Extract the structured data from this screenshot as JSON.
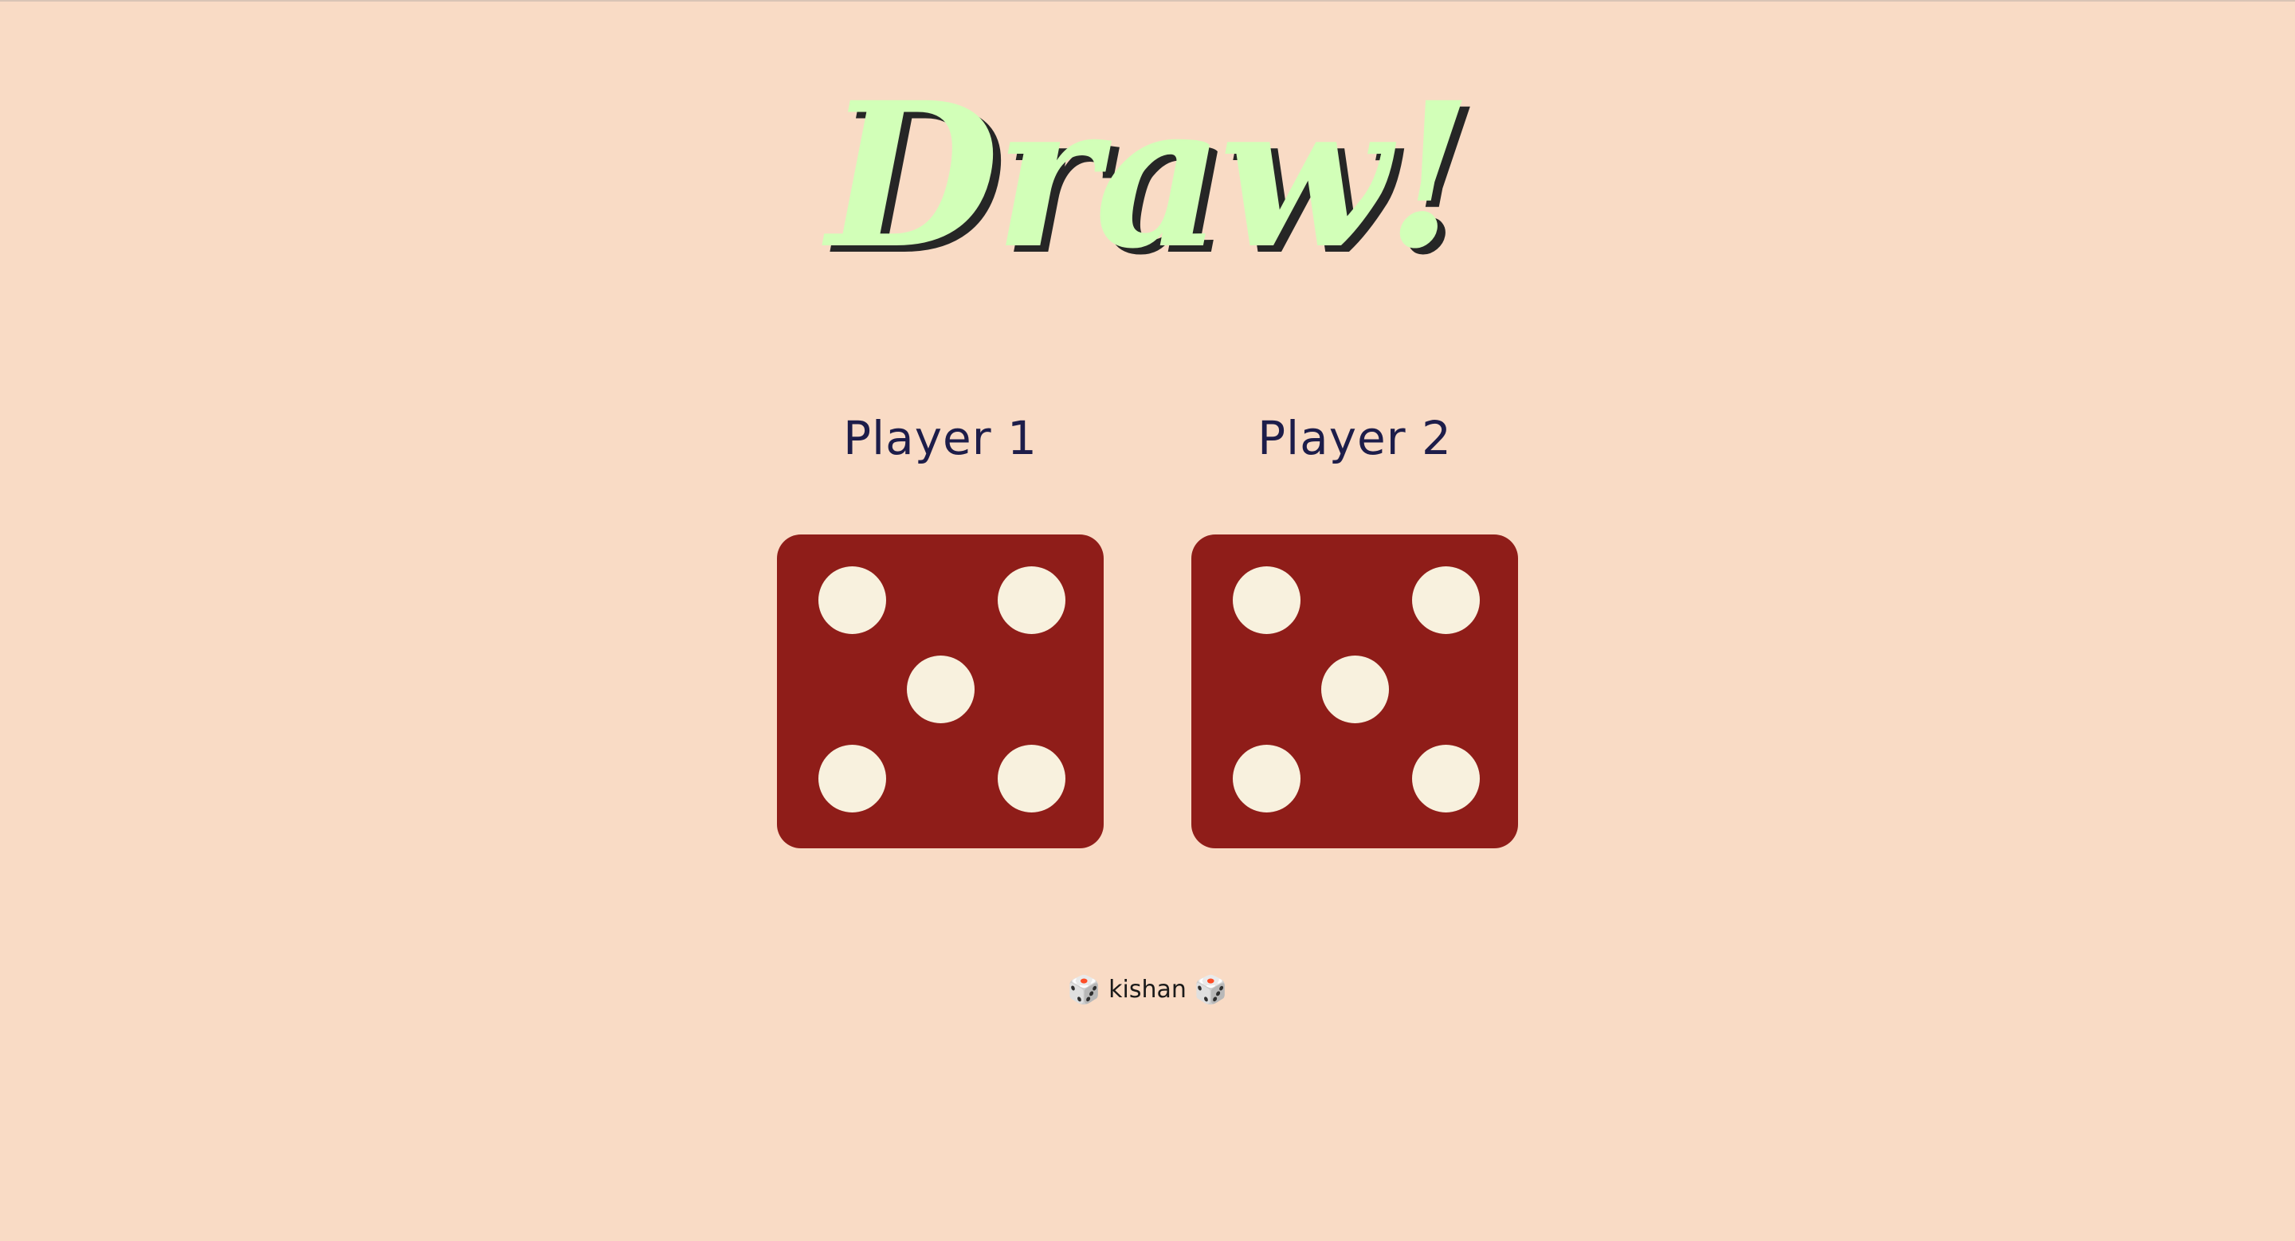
{
  "title": "Draw!",
  "players": [
    {
      "label": "Player 1",
      "die_value": 5
    },
    {
      "label": "Player 2",
      "die_value": 5
    }
  ],
  "footer": {
    "icon_left": "🎲",
    "author": "kishan",
    "icon_right": "🎲"
  },
  "colors": {
    "background": "#f9dbc5",
    "title": "#d2ffb8",
    "title_shadow": "#262626",
    "die": "#8f1d19",
    "pip": "#f8f1de",
    "player_label": "#1d1d4a"
  }
}
